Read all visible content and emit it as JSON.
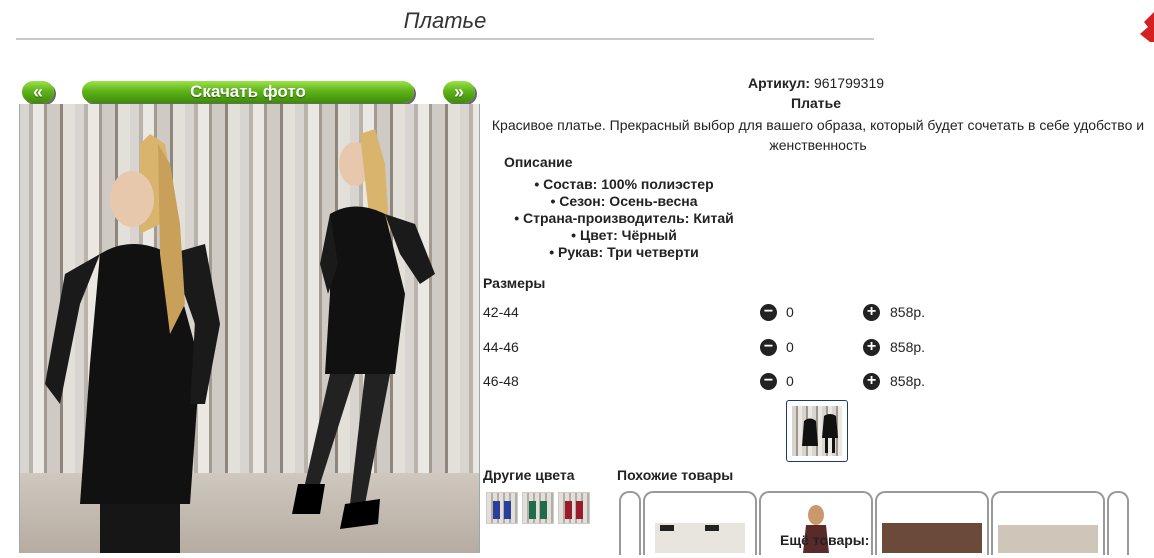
{
  "page": {
    "title": "Платье"
  },
  "gallery": {
    "prev_label": "«",
    "download_label": "Скачать фото",
    "next_label": "»"
  },
  "product": {
    "article_label": "Артикул:",
    "article_value": "961799319",
    "name": "Платье",
    "description": "Красивое платье. Прекрасный выбор для вашего образа, который будет сочетать в себе удобство и женственность",
    "desc_heading": "Описание",
    "properties": [
      "Состав: 100% полиэстер",
      "Сезон: Осень-весна",
      "Страна-производитель: Китай",
      "Цвет: Чёрный",
      "Рукав: Три четверти"
    ]
  },
  "sizes": {
    "heading": "Размеры",
    "rows": [
      {
        "size": "42-44",
        "qty": "0",
        "price": "858р."
      },
      {
        "size": "44-46",
        "qty": "0",
        "price": "858р."
      },
      {
        "size": "46-48",
        "qty": "0",
        "price": "858р."
      }
    ]
  },
  "other_colors": {
    "heading": "Другие цвета",
    "swatches": [
      "blue",
      "green",
      "red"
    ]
  },
  "similar": {
    "heading": "Похожие товары",
    "more_label": "Ещё товары:"
  },
  "colors": {
    "accent_green": "#5fb41a",
    "thumb_border": "#1a3b6d"
  }
}
